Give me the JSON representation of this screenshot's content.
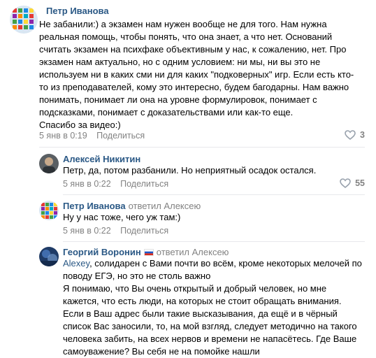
{
  "comments": [
    {
      "author": "Петр Иванова",
      "replied_to": "",
      "text_lines": [
        "Не забанили:) а экзамен нам нужен вообще не для того. Нам нужна",
        "реальная помощь, чтобы понять, что она знает, а что нет. Оснований",
        "считать экзамен на психфаке объективным у нас, к сожалению, нет. Про",
        "экзамен нам актуально, но с одним условием: ни мы, ни вы это не",
        "используем ни в каких сми ни для каких \"подковерных\" игр. Если есть кто-",
        "то из преподавателей, кому это интересно, будем багодарны. Нам важно",
        "понимать, понимает ли она на уровне формулировок, понимает с",
        "подсказками, понимает с доказательствами или как-то еще.",
        "Спасибо за видео:)"
      ],
      "date": "5 янв в 0:19",
      "share": "Поделиться",
      "likes": "3"
    },
    {
      "author": "Алексей Никитин",
      "replied_to": "",
      "text_lines": [
        "Петр, да, потом разбанили. Но неприятный осадок остался."
      ],
      "date": "5 янв в 0:22",
      "share": "Поделиться",
      "likes": "55"
    },
    {
      "author": "Петр Иванова",
      "replied_to": "ответил Алексею",
      "text_lines": [
        "Ну у нас тоже, чего уж там:)"
      ],
      "date": "5 янв в 0:22",
      "share": "Поделиться",
      "likes": ""
    },
    {
      "author": "Георгий Воронин",
      "replied_to": "ответил Алексею",
      "addressee": "Alexey",
      "text_first_rest": ", солидарен с Вами почти во всём, кроме некоторых мелочей по",
      "text_lines": [
        "поводу ЕГЭ, но это не столь важно",
        "Я понимаю, что Вы очень открытый и добрый человек, но мне",
        "кажется, что есть люди, на которых не стоит обращать внимания.",
        "Если в Ваш адрес были такие высказывания, да ещё и в чёрный",
        "список Вас заносили, то, на мой взгляд, следует методично на такого",
        "человека забить, на всех нервов и времени не напасётесь. Где Ваше",
        "самоуважение? Вы себя не на помойке нашли"
      ]
    }
  ],
  "icons": {
    "like": "heart-icon",
    "flag": "russia-flag-icon"
  }
}
